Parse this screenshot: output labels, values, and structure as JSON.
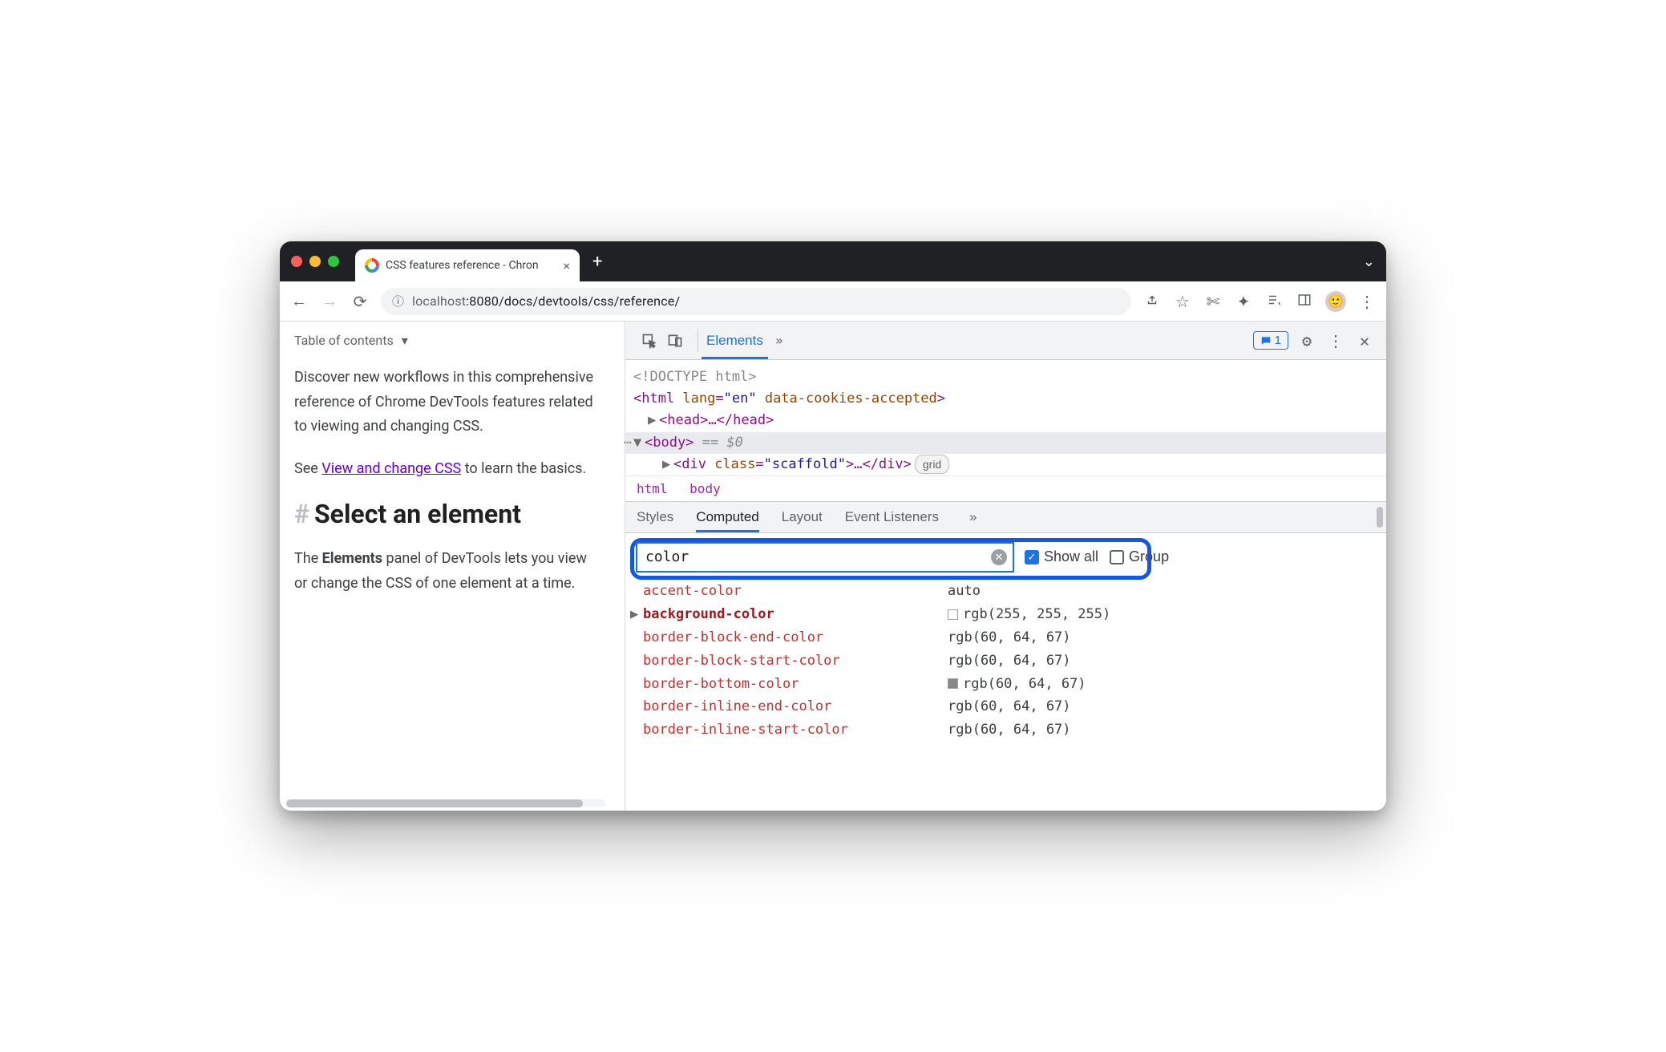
{
  "browser": {
    "tab_title": "CSS features reference - Chron",
    "url_prefix": "localhost",
    "url_port": ":8080",
    "url_path": "/docs/devtools/css/reference/"
  },
  "page": {
    "toc_label": "Table of contents",
    "intro": "Discover new workflows in this comprehensive reference of Chrome DevTools features related to viewing and changing CSS.",
    "see": "See ",
    "link": "View and change CSS",
    "see_tail": " to learn the basics.",
    "heading": "Select an element",
    "body1_a": "The ",
    "body1_b": "Elements",
    "body1_c": " panel of DevTools lets you view or change the CSS of one element at a time."
  },
  "devtools": {
    "tabs": {
      "elements": "Elements"
    },
    "issues_count": "1",
    "dom": {
      "doctype": "<!DOCTYPE html>",
      "html_open": "<html ",
      "html_lang_n": "lang",
      "html_lang_v": "\"en\"",
      "html_attr2": "data-cookies-accepted",
      "html_close": ">",
      "head": "<head>…</head>",
      "body": "<body>",
      "eq": " == ",
      "dollar": "$0",
      "div_a": "<div ",
      "div_cls_n": "class",
      "div_cls_v": "\"scaffold\"",
      "div_b": ">…</div>",
      "grid": "grid"
    },
    "crumbs": {
      "a": "html",
      "b": "body"
    },
    "subtabs": {
      "styles": "Styles",
      "computed": "Computed",
      "layout": "Layout",
      "events": "Event Listeners"
    },
    "filter_value": "color",
    "show_all": "Show all",
    "group": "Group",
    "props": [
      {
        "name": "accent-color",
        "val": "auto",
        "sw": "",
        "bold": false,
        "exp": ""
      },
      {
        "name": "background-color",
        "val": "rgb(255, 255, 255)",
        "sw": "white",
        "bold": true,
        "exp": "▶"
      },
      {
        "name": "border-block-end-color",
        "val": "rgb(60, 64, 67)",
        "sw": "",
        "bold": false,
        "exp": ""
      },
      {
        "name": "border-block-start-color",
        "val": "rgb(60, 64, 67)",
        "sw": "",
        "bold": false,
        "exp": ""
      },
      {
        "name": "border-bottom-color",
        "val": "rgb(60, 64, 67)",
        "sw": "gray",
        "bold": false,
        "exp": ""
      },
      {
        "name": "border-inline-end-color",
        "val": "rgb(60, 64, 67)",
        "sw": "",
        "bold": false,
        "exp": ""
      },
      {
        "name": "border-inline-start-color",
        "val": "rgb(60, 64, 67)",
        "sw": "",
        "bold": false,
        "exp": ""
      }
    ]
  }
}
